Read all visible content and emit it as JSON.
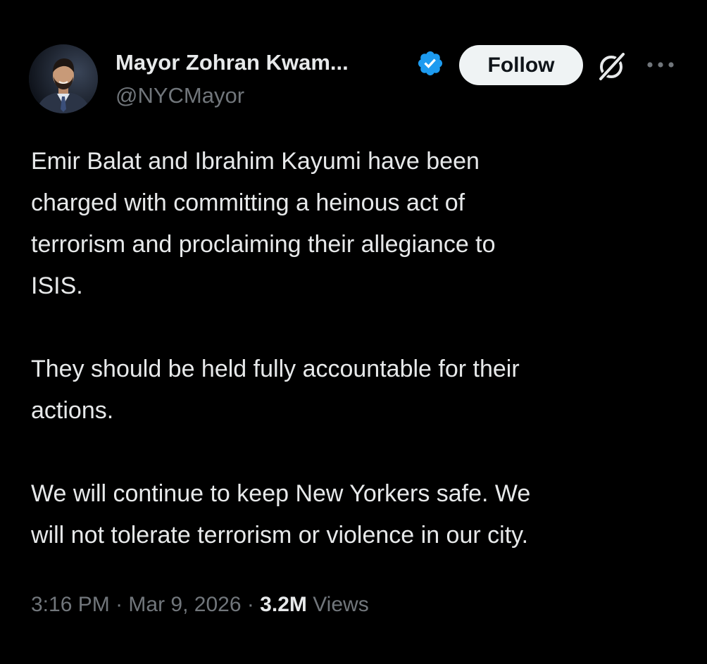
{
  "author": {
    "display_name": "Mayor Zohran Kwam...",
    "handle": "@NYCMayor",
    "verified": true
  },
  "actions": {
    "follow_label": "Follow",
    "grok_icon": "grok-icon",
    "more_icon": "more-options-icon"
  },
  "post": {
    "paragraphs": [
      "Emir Balat and Ibrahim Kayumi have been\ncharged with committing a heinous act of\nterrorism and proclaiming their allegiance to\nISIS.",
      "They should be held fully accountable for their\nactions.",
      "We will continue to keep New Yorkers safe. We\nwill not tolerate terrorism or violence in our city."
    ]
  },
  "meta": {
    "time": "3:16 PM",
    "separator": " · ",
    "date": "Mar 9, 2026",
    "views_count": "3.2M",
    "views_label": " Views"
  },
  "colors": {
    "background": "#000000",
    "text_primary": "#e7e9ea",
    "text_secondary": "#71767b",
    "verified_badge": "#1d9bf0",
    "follow_button_bg": "#eff3f4"
  }
}
